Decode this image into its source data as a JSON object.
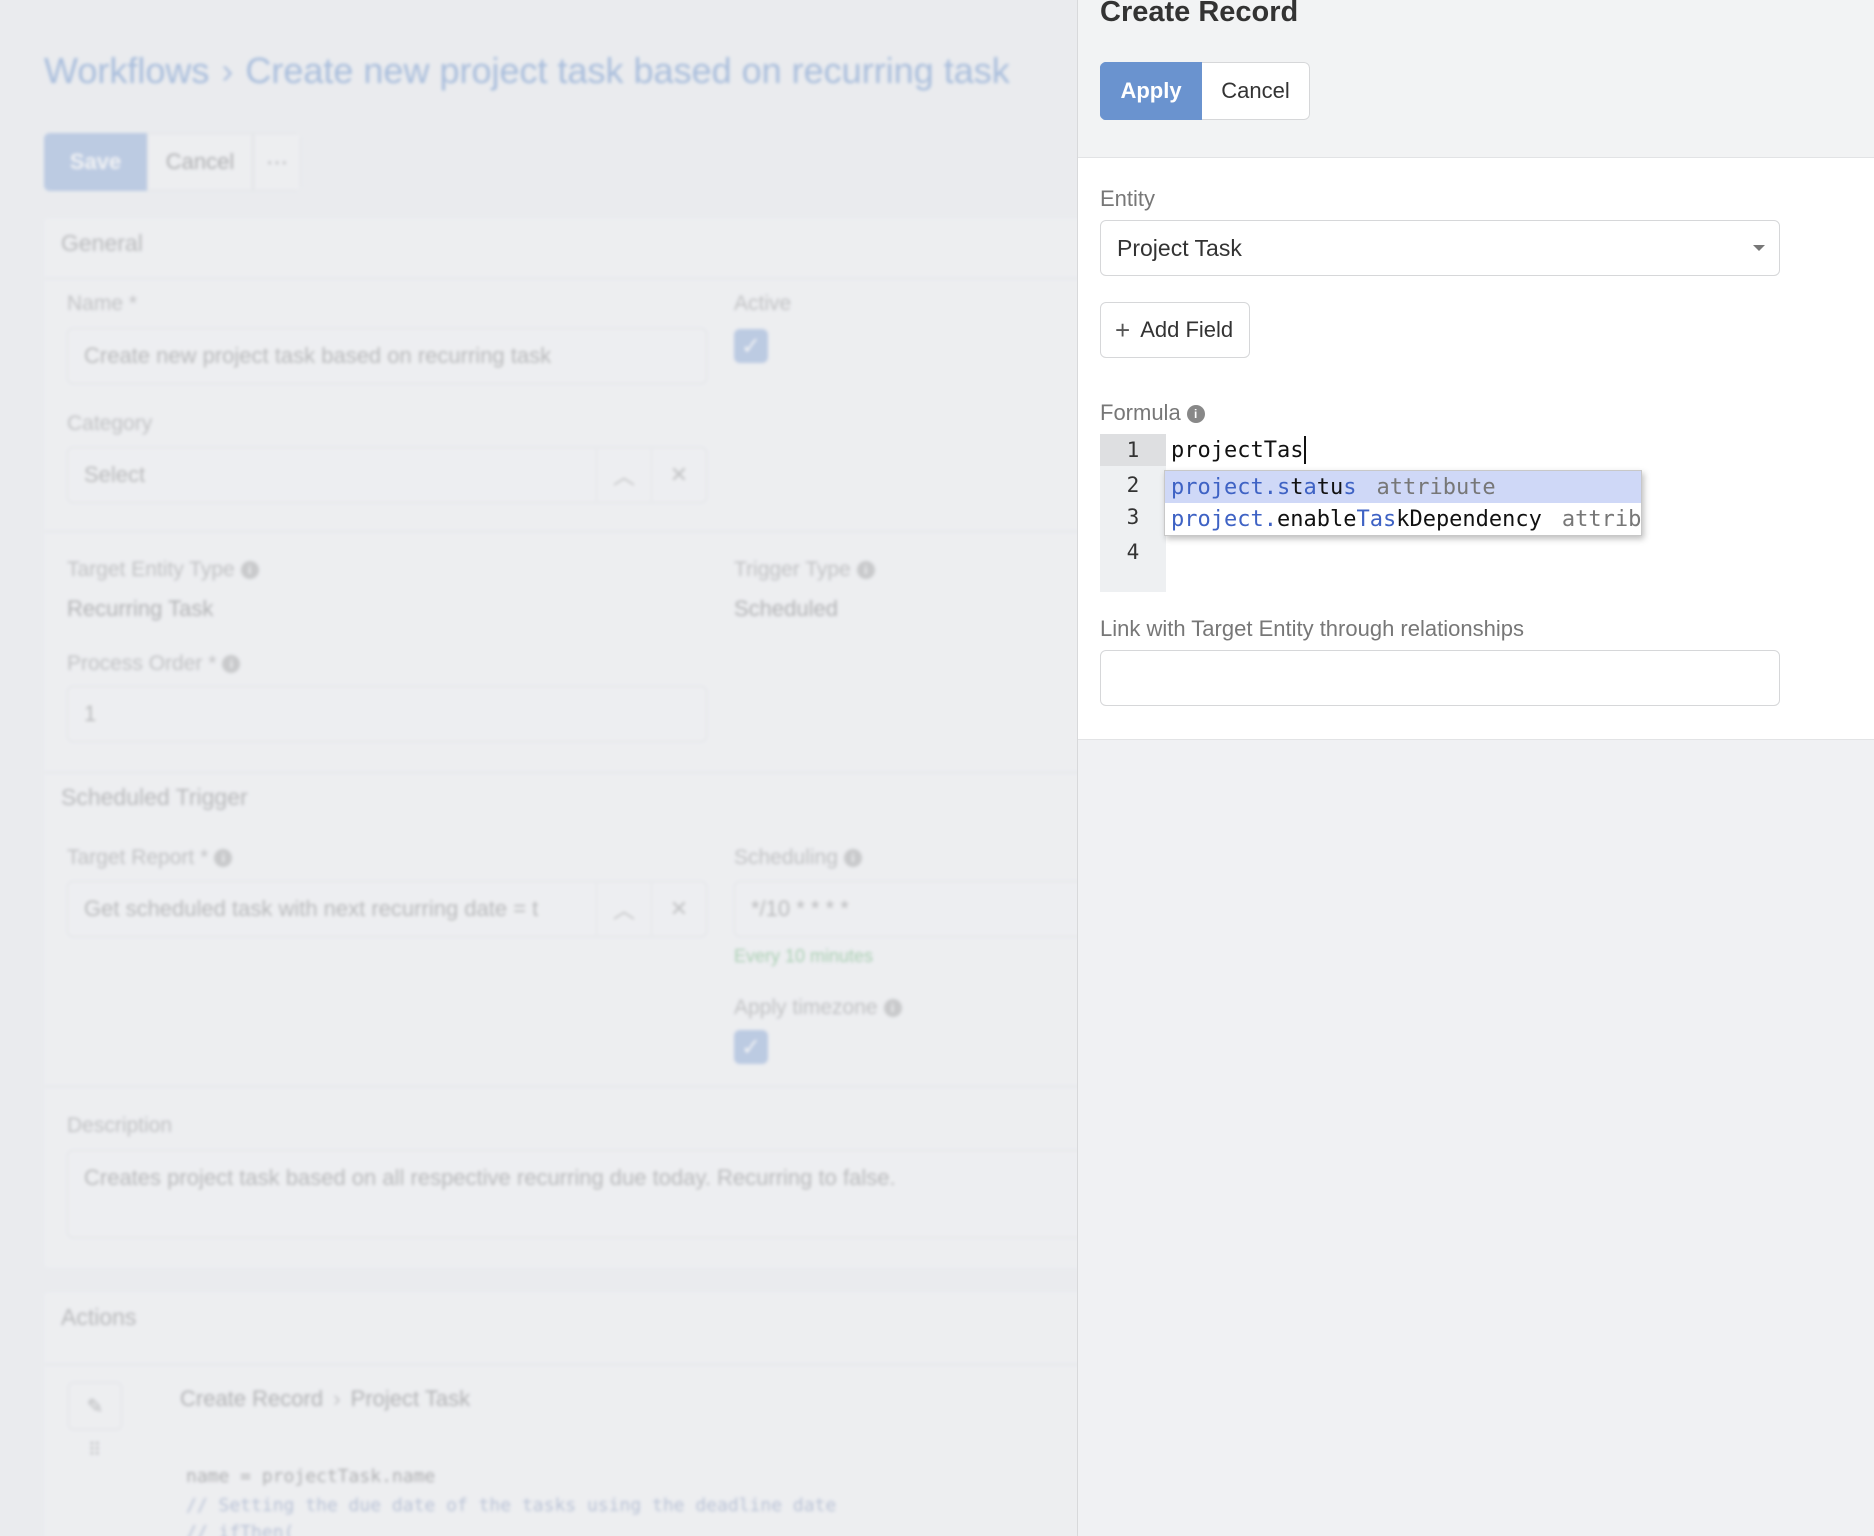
{
  "background": {
    "breadcrumb": {
      "root": "Workflows",
      "separator": "›",
      "current": "Create new project task based on recurring task"
    },
    "toolbar": {
      "save_label": "Save",
      "cancel_label": "Cancel",
      "more_label": "···"
    },
    "general": {
      "title": "General",
      "name_label": "Name *",
      "name_value": "Create new project task based on recurring task",
      "active_label": "Active",
      "category_label": "Category",
      "category_placeholder": "Select",
      "target_entity_type_label": "Target Entity Type",
      "target_entity_type_value": "Recurring Task",
      "trigger_type_label": "Trigger Type",
      "trigger_type_value": "Scheduled",
      "process_order_label": "Process Order *",
      "process_order_value": "1"
    },
    "scheduled_trigger": {
      "title": "Scheduled Trigger",
      "target_report_label": "Target Report *",
      "target_report_value": "Get scheduled task with next recurring date = t",
      "scheduling_label": "Scheduling",
      "scheduling_value": "*/10 * * * *",
      "scheduling_hint": "Every 10 minutes",
      "apply_timezone_label": "Apply timezone"
    },
    "description": {
      "label": "Description",
      "value": "Creates project task based on all respective recurring due today.  Recurring to false."
    },
    "actions": {
      "title": "Actions",
      "action_entity": "Create Record",
      "action_separator": "›",
      "action_target": "Project Task",
      "code_line_1": "name = projectTask.name",
      "code_line_2": "// Setting the due date of the tasks using the deadline date",
      "code_line_3": "// ifThen("
    }
  },
  "panel": {
    "title": "Create Record",
    "apply_label": "Apply",
    "cancel_label": "Cancel",
    "entity_label": "Entity",
    "entity_value": "Project Task",
    "add_field_label": "Add Field",
    "formula_label": "Formula",
    "editor": {
      "line_numbers": [
        "1",
        "2",
        "3",
        "4"
      ],
      "line_1": "projectTas"
    },
    "autocomplete": [
      {
        "prefix": "project.",
        "m1": "s",
        "t1": "t",
        "m2": "a",
        "t2": "tu",
        "m3": "s",
        "type": "attribute"
      },
      {
        "prefix": "project.",
        "t1": "enable",
        "m1": "Tas",
        "t2": "kDependency",
        "type": "attribute"
      }
    ],
    "link_label": "Link with Target Entity through relationships",
    "link_value": ""
  },
  "colors": {
    "primary": "#6a93cf",
    "primary_faded": "#9fb8df",
    "link": "#7b9fd3",
    "hint_green": "#7fc08a",
    "ac_selected": "#cfd8f7"
  }
}
